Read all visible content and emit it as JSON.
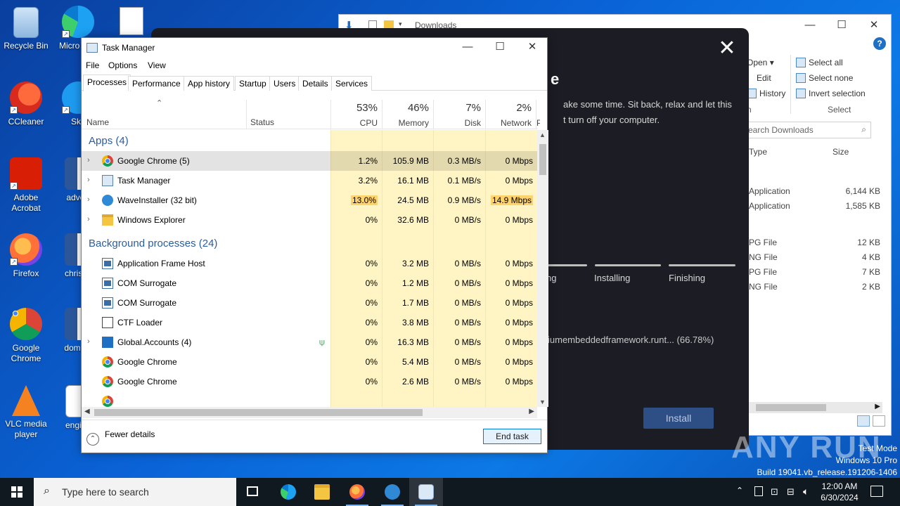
{
  "desktop": {
    "icons": [
      {
        "label": "Recycle Bin"
      },
      {
        "label": "Micro Edg"
      },
      {
        "label": "CCleaner"
      },
      {
        "label": "Sky"
      },
      {
        "label": "Adobe Acrobat"
      },
      {
        "label": "advert"
      },
      {
        "label": "Firefox"
      },
      {
        "label": "christia"
      },
      {
        "label": "Google Chrome"
      },
      {
        "label": "domain"
      },
      {
        "label": "VLC media player"
      },
      {
        "label": "engine"
      }
    ]
  },
  "explorer": {
    "title": "Downloads",
    "ribbon": {
      "open": "Open",
      "edit": "Edit",
      "history": "History",
      "open_group": "n",
      "select_all": "Select all",
      "select_none": "Select none",
      "invert_selection": "Invert selection",
      "select_group": "Select"
    },
    "search_placeholder": "earch Downloads",
    "columns": {
      "type": "Type",
      "size": "Size"
    },
    "rows": [
      {
        "type": "Application",
        "size": "6,144 KB"
      },
      {
        "type": "Application",
        "size": "1,585 KB"
      },
      {
        "type": "PG File",
        "size": "12 KB"
      },
      {
        "type": "NG File",
        "size": "4 KB"
      },
      {
        "type": "PG File",
        "size": "7 KB"
      },
      {
        "type": "NG File",
        "size": "2 KB"
      }
    ]
  },
  "installer": {
    "heading": "e",
    "description_line1": "ake some time. Sit back, relax and let this",
    "description_line2": "t turn off your computer.",
    "steps": [
      "ng",
      "Installing",
      "Finishing"
    ],
    "progress_text": "iumembeddedframework.runt... (66.78%)",
    "install_button": "Install"
  },
  "task_manager": {
    "title": "Task Manager",
    "menu": [
      "File",
      "Options",
      "View"
    ],
    "tabs": [
      "Processes",
      "Performance",
      "App history",
      "Startup",
      "Users",
      "Details",
      "Services"
    ],
    "active_tab": "Processes",
    "headers": {
      "name": "Name",
      "status": "Status",
      "cpu": {
        "pct": "53%",
        "label": "CPU"
      },
      "memory": {
        "pct": "46%",
        "label": "Memory"
      },
      "disk": {
        "pct": "7%",
        "label": "Disk"
      },
      "network": {
        "pct": "2%",
        "label": "Network"
      },
      "power": "P"
    },
    "apps_group": "Apps (4)",
    "apps": [
      {
        "name": "Google Chrome (5)",
        "icon": "chrome-icon",
        "cpu": "1.2%",
        "memory": "105.9 MB",
        "disk": "0.3 MB/s",
        "network": "0 Mbps"
      },
      {
        "name": "Task Manager",
        "icon": "task-manager-icon",
        "cpu": "3.2%",
        "memory": "16.1 MB",
        "disk": "0.1 MB/s",
        "network": "0 Mbps"
      },
      {
        "name": "WaveInstaller (32 bit)",
        "icon": "wave-icon",
        "cpu": "13.0%",
        "memory": "24.5 MB",
        "disk": "0.9 MB/s",
        "network": "14.9 Mbps"
      },
      {
        "name": "Windows Explorer",
        "icon": "folder-icon",
        "cpu": "0%",
        "memory": "32.6 MB",
        "disk": "0 MB/s",
        "network": "0 Mbps"
      }
    ],
    "background_group": "Background processes (24)",
    "background": [
      {
        "name": "Application Frame Host",
        "icon": "window-icon",
        "cpu": "0%",
        "memory": "3.2 MB",
        "disk": "0 MB/s",
        "network": "0 Mbps"
      },
      {
        "name": "COM Surrogate",
        "icon": "window-icon",
        "cpu": "0%",
        "memory": "1.2 MB",
        "disk": "0 MB/s",
        "network": "0 Mbps"
      },
      {
        "name": "COM Surrogate",
        "icon": "window-icon",
        "cpu": "0%",
        "memory": "1.7 MB",
        "disk": "0 MB/s",
        "network": "0 Mbps"
      },
      {
        "name": "CTF Loader",
        "icon": "ctf-icon",
        "cpu": "0%",
        "memory": "3.8 MB",
        "disk": "0 MB/s",
        "network": "0 Mbps"
      },
      {
        "name": "Global.Accounts (4)",
        "icon": "accounts-icon",
        "cpu": "0%",
        "memory": "16.3 MB",
        "disk": "0 MB/s",
        "network": "0 Mbps"
      },
      {
        "name": "Google Chrome",
        "icon": "chrome-icon",
        "cpu": "0%",
        "memory": "5.4 MB",
        "disk": "0 MB/s",
        "network": "0 Mbps"
      },
      {
        "name": "Google Chrome",
        "icon": "chrome-icon",
        "cpu": "0%",
        "memory": "2.6 MB",
        "disk": "0 MB/s",
        "network": "0 Mbps"
      }
    ],
    "fewer_details": "Fewer details",
    "end_task": "End task"
  },
  "watermark": {
    "text": "ANY RUN",
    "mode": "Test Mode",
    "edition": "Windows 10 Pro",
    "build": "Build 19041.vb_release.191206-1406"
  },
  "taskbar": {
    "search_placeholder": "Type here to search",
    "time": "12:00 AM",
    "date": "6/30/2024"
  },
  "colors": {
    "accent": "#0078d7",
    "heat_low": "#fff4c4",
    "heat_mid": "#ffe99c",
    "heat_high": "#ffd36b",
    "installer_bg": "#1c1d24"
  }
}
